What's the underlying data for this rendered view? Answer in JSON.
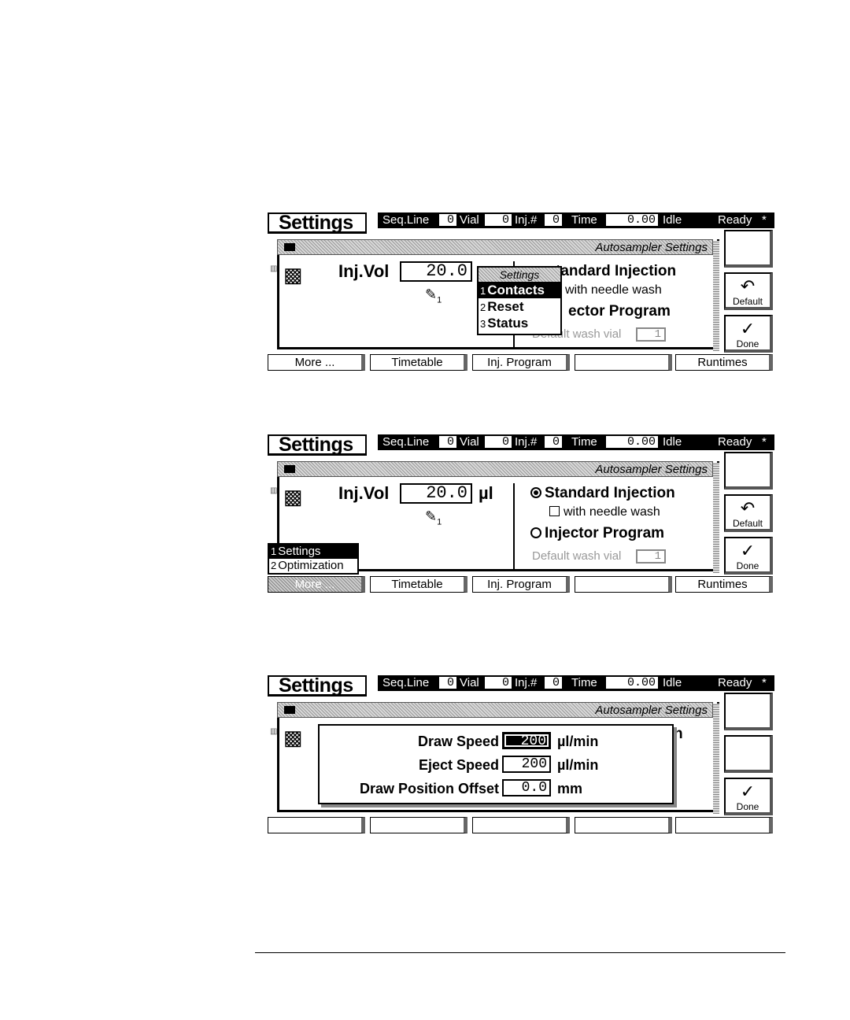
{
  "screens": [
    {
      "title": "Settings",
      "status": {
        "seq_label": "Seq.Line",
        "seq": "0",
        "vial_label": "Vial",
        "vial": "0",
        "inj_label": "Inj.#",
        "inj": "0",
        "time_label": "Time",
        "time": "0.00",
        "idle": "Idle",
        "ready": "Ready",
        "star": "*"
      },
      "panel_title": "Autosampler Settings",
      "inj_vol_label": "Inj.Vol",
      "inj_vol_value": "20.0",
      "injector_sub": "1",
      "opt_standard": "tandard Injection",
      "opt_needle": "with needle wash",
      "opt_program": "ector Program",
      "wash_label": "Default wash vial",
      "wash_value": "1",
      "popup": {
        "header": "Settings",
        "items": [
          {
            "num": "1",
            "label": "Contacts",
            "selected": true
          },
          {
            "num": "2",
            "label": "Reset",
            "selected": false
          },
          {
            "num": "3",
            "label": "Status",
            "selected": false
          }
        ]
      },
      "right_buttons": {
        "default": "Default",
        "done": "Done"
      },
      "fkeys": [
        "More ...",
        "Timetable",
        "Inj. Program",
        "",
        "Runtimes"
      ]
    },
    {
      "title": "Settings",
      "status": {
        "seq_label": "Seq.Line",
        "seq": "0",
        "vial_label": "Vial",
        "vial": "0",
        "inj_label": "Inj.#",
        "inj": "0",
        "time_label": "Time",
        "time": "0.00",
        "idle": "Idle",
        "ready": "Ready",
        "star": "*"
      },
      "panel_title": "Autosampler Settings",
      "inj_vol_label": "Inj.Vol",
      "inj_vol_value": "20.0",
      "inj_vol_unit": "µl",
      "injector_sub": "1",
      "opt_standard": "Standard Injection",
      "opt_needle": "with needle wash",
      "opt_program": "Injector Program",
      "wash_label": "Default wash vial",
      "wash_value": "1",
      "more_menu": [
        {
          "num": "1",
          "label": "Settings",
          "selected": true
        },
        {
          "num": "2",
          "label": "Optimization",
          "selected": false
        }
      ],
      "right_buttons": {
        "default": "Default",
        "done": "Done"
      },
      "fkeys": [
        "More ...",
        "Timetable",
        "Inj. Program",
        "",
        "Runtimes"
      ]
    },
    {
      "title": "Settings",
      "status": {
        "seq_label": "Seq.Line",
        "seq": "0",
        "vial_label": "Vial",
        "vial": "0",
        "inj_label": "Inj.#",
        "inj": "0",
        "time_label": "Time",
        "time": "0.00",
        "idle": "Idle",
        "ready": "Ready",
        "star": "*"
      },
      "panel_title": "Autosampler Settings",
      "partial_text": "h",
      "dialog": [
        {
          "label": "Draw Speed",
          "value": "200",
          "unit": "µl/min"
        },
        {
          "label": "Eject Speed",
          "value": "200",
          "unit": "µl/min"
        },
        {
          "label": "Draw Position Offset",
          "value": "0.0",
          "unit": "mm"
        }
      ],
      "right_buttons": {
        "done": "Done"
      },
      "fkeys": [
        "",
        "",
        "",
        "",
        ""
      ]
    }
  ]
}
